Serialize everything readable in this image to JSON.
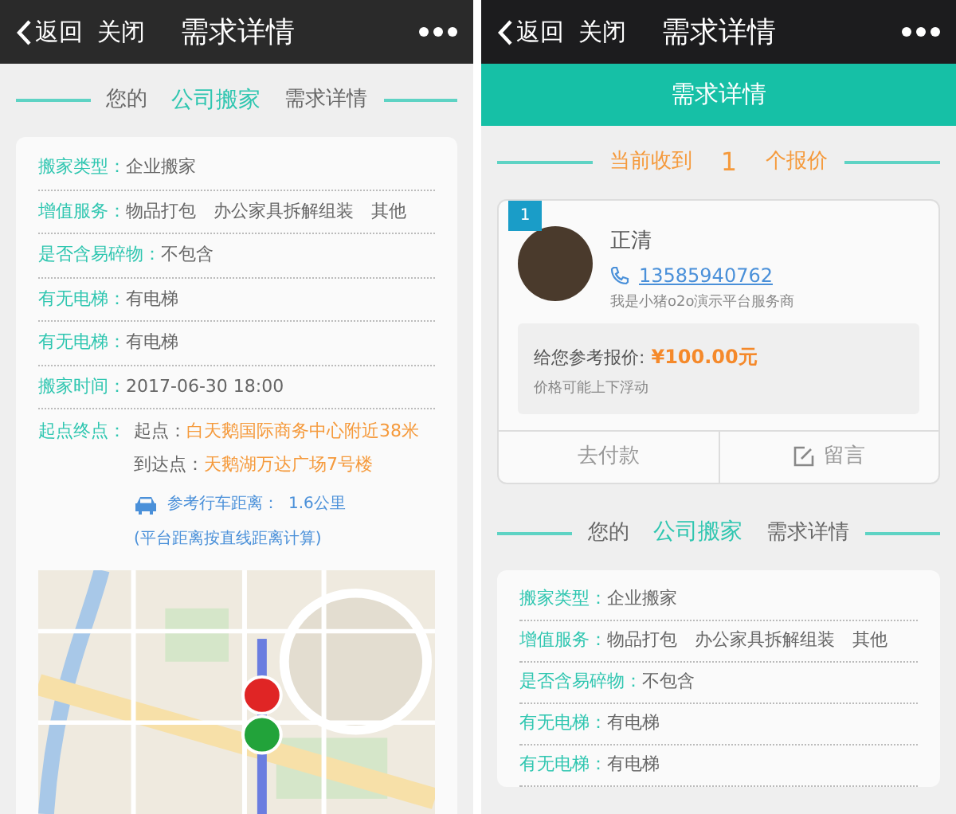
{
  "left": {
    "navbar": {
      "back": "返回",
      "close": "关闭",
      "title": "需求详情"
    },
    "section_heading": {
      "prefix": "您的",
      "highlight": "公司搬家",
      "suffix": "需求详情"
    },
    "details": [
      {
        "kind": "text",
        "label": "搬家类型：",
        "values": [
          "企业搬家"
        ]
      },
      {
        "kind": "text",
        "label": "增值服务：",
        "values": [
          "物品打包",
          "办公家具拆解组装",
          "其他"
        ]
      },
      {
        "kind": "text",
        "label": "是否含易碎物：",
        "values": [
          "不包含"
        ]
      },
      {
        "kind": "text",
        "label": "有无电梯：",
        "values": [
          "有电梯"
        ]
      },
      {
        "kind": "text",
        "label": "有无电梯：",
        "values": [
          "有电梯"
        ]
      },
      {
        "kind": "text",
        "label": "搬家时间：",
        "values": [
          "2017-06-30 18:00"
        ]
      },
      {
        "kind": "route",
        "label": "起点终点：",
        "start_label": "起点：",
        "start": "白天鹅国际商务中心附近38米",
        "end_label": "到达点：",
        "end": "天鹅湖万达广场7号楼",
        "distance_label": "参考行车距离：",
        "distance": "1.6公里",
        "note": "(平台距离按直线距离计算)"
      }
    ]
  },
  "right": {
    "navbar": {
      "back": "返回",
      "close": "关闭",
      "title": "需求详情"
    },
    "tab_bar": {
      "title": "需求详情"
    },
    "quotes_heading": {
      "prefix": "当前收到",
      "count": "1",
      "suffix": "个报价"
    },
    "quotes": [
      {
        "index": "1",
        "name": "正清",
        "phone": "13585940762",
        "intro": "我是小猪o2o演示平台服务商",
        "price_label": "给您参考报价:",
        "price": "¥100.00元",
        "price_note": "价格可能上下浮动",
        "actions": [
          {
            "kind": "pay",
            "label": "去付款"
          },
          {
            "kind": "message",
            "label": "留言"
          }
        ]
      }
    ],
    "section_heading": {
      "prefix": "您的",
      "highlight": "公司搬家",
      "suffix": "需求详情"
    },
    "details": [
      {
        "kind": "text",
        "label": "搬家类型：",
        "values": [
          "企业搬家"
        ]
      },
      {
        "kind": "text",
        "label": "增值服务：",
        "values": [
          "物品打包",
          "办公家具拆解组装",
          "其他"
        ]
      },
      {
        "kind": "text",
        "label": "是否含易碎物：",
        "values": [
          "不包含"
        ]
      },
      {
        "kind": "text",
        "label": "有无电梯：",
        "values": [
          "有电梯"
        ]
      },
      {
        "kind": "text",
        "label": "有无电梯：",
        "values": [
          "有电梯"
        ]
      }
    ]
  }
}
